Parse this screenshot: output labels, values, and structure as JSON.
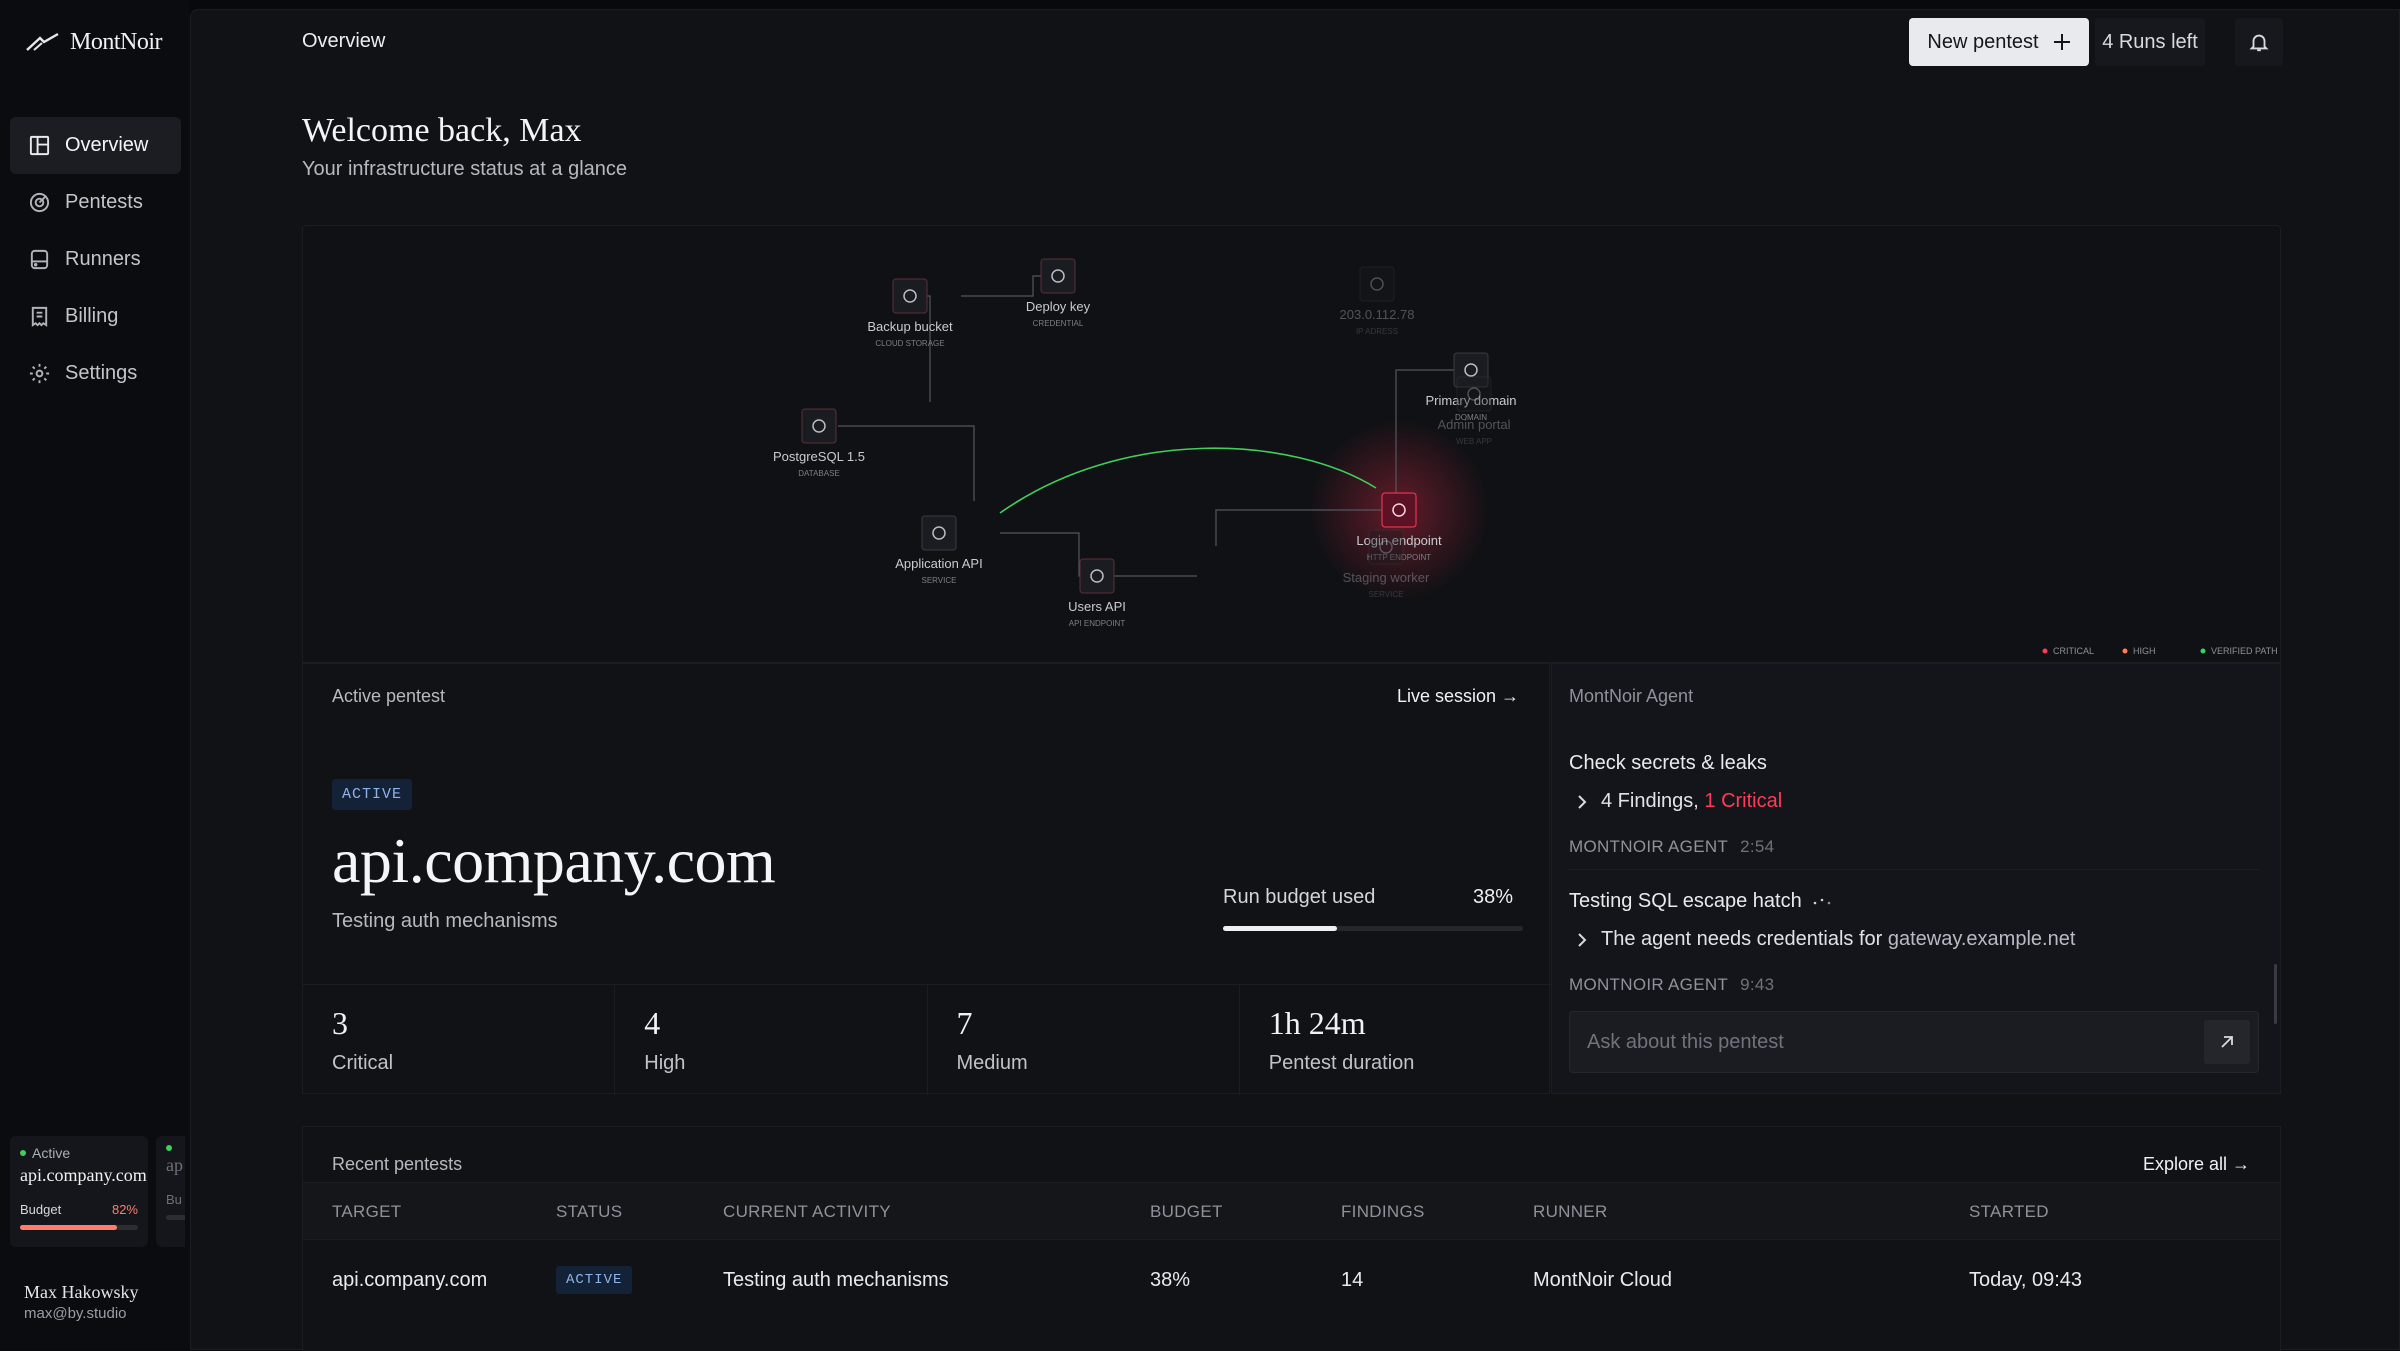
{
  "app": {
    "logo_text": "MontNoir"
  },
  "sidebar": {
    "items": [
      {
        "label": "Overview",
        "icon": "layout-icon"
      },
      {
        "label": "Pentests",
        "icon": "target-icon"
      },
      {
        "label": "Runners",
        "icon": "server-icon"
      },
      {
        "label": "Billing",
        "icon": "receipt-icon"
      },
      {
        "label": "Settings",
        "icon": "gear-icon"
      }
    ],
    "mini_card": {
      "status": "Active",
      "target": "api.company.com",
      "budget_label": "Budget",
      "budget_value": "82%",
      "budget_fraction": 0.82,
      "peek_target": "ap",
      "peek_budget": "Bu"
    },
    "user": {
      "name": "Max Hakowsky",
      "email": "max@by.studio"
    }
  },
  "header": {
    "title": "Overview",
    "new_pentest": "New pentest",
    "runs_left": "4 Runs left"
  },
  "welcome": {
    "title": "Welcome back, Max",
    "subtitle": "Your infrastructure status at a glance"
  },
  "graph": {
    "nodes": [
      {
        "name": "Backup bucket",
        "type": "CLOUD STORAGE"
      },
      {
        "name": "Deploy key",
        "type": "CREDENTIAL"
      },
      {
        "name": "PostgreSQL 1.5",
        "type": "DATABASE"
      },
      {
        "name": "Application API",
        "type": "SERVICE"
      },
      {
        "name": "Users API",
        "type": "API ENDPOINT"
      },
      {
        "name": "Login endpoint",
        "type": "HTTP ENDPOINT"
      },
      {
        "name": "Primary domain",
        "type": "DOMAIN"
      },
      {
        "name": "203.0.112.78",
        "type": "IP ADRESS"
      },
      {
        "name": "Admin portal",
        "type": "WEB APP"
      },
      {
        "name": "Staging worker",
        "type": "SERVICE"
      }
    ],
    "legend": {
      "critical": "CRITICAL",
      "high": "HIGH",
      "verified": "VERIFIED PATH"
    },
    "colors": {
      "critical": "#ff3b57",
      "high": "#ff7d4f",
      "verified": "#3fcf5b"
    }
  },
  "active_pentest": {
    "header": "Active pentest",
    "live_session": "Live session →",
    "status": "ACTIVE",
    "target": "api.company.com",
    "activity": "Testing auth mechanisms",
    "budget_label": "Run budget used",
    "budget_value": "38%",
    "budget_fraction": 0.38,
    "stats": [
      {
        "value": "3",
        "label": "Critical"
      },
      {
        "value": "4",
        "label": "High"
      },
      {
        "value": "7",
        "label": "Medium"
      },
      {
        "value": "1h 24m",
        "label": "Pentest duration"
      }
    ]
  },
  "agent": {
    "header": "MontNoir Agent",
    "messages": [
      {
        "title": "Check secrets & leaks",
        "detail_prefix": "4 Findings, ",
        "detail_highlight": "1 Critical",
        "author": "MONTNOIR AGENT",
        "time": "2:54"
      },
      {
        "title": "Testing SQL escape hatch",
        "detail_prefix": "The agent needs credentials for ",
        "detail_highlight": "gateway.example.net",
        "author": "MONTNOIR AGENT",
        "time": "9:43"
      }
    ],
    "ask_placeholder": "Ask about this pentest"
  },
  "recent": {
    "header": "Recent pentests",
    "explore": "Explore all →",
    "columns": [
      "TARGET",
      "STATUS",
      "CURRENT ACTIVITY",
      "BUDGET",
      "FINDINGS",
      "RUNNER",
      "STARTED"
    ],
    "rows": [
      {
        "target": "api.company.com",
        "status": "ACTIVE",
        "activity": "Testing auth mechanisms",
        "budget": "38%",
        "findings": "14",
        "runner": "MontNoir Cloud",
        "started": "Today, 09:43"
      }
    ]
  }
}
